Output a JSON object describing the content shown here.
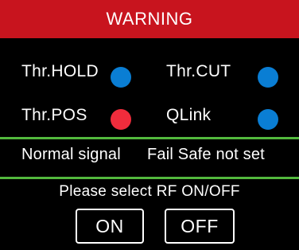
{
  "title": "WARNING",
  "colors": {
    "title_bar": "#c8141e",
    "background": "#000000",
    "divider": "#52b83d",
    "status_ok": "#0a7ed4",
    "status_alert": "#f02c3c"
  },
  "status_items": [
    {
      "label": "Thr.HOLD",
      "state": "blue"
    },
    {
      "label": "Thr.CUT",
      "state": "blue"
    },
    {
      "label": "Thr.POS",
      "state": "red"
    },
    {
      "label": "QLink",
      "state": "blue"
    }
  ],
  "signal": {
    "normal": "Normal signal",
    "failsafe": "Fail Safe not set"
  },
  "rf": {
    "prompt": "Please select RF ON/OFF",
    "on_label": "ON",
    "off_label": "OFF"
  }
}
